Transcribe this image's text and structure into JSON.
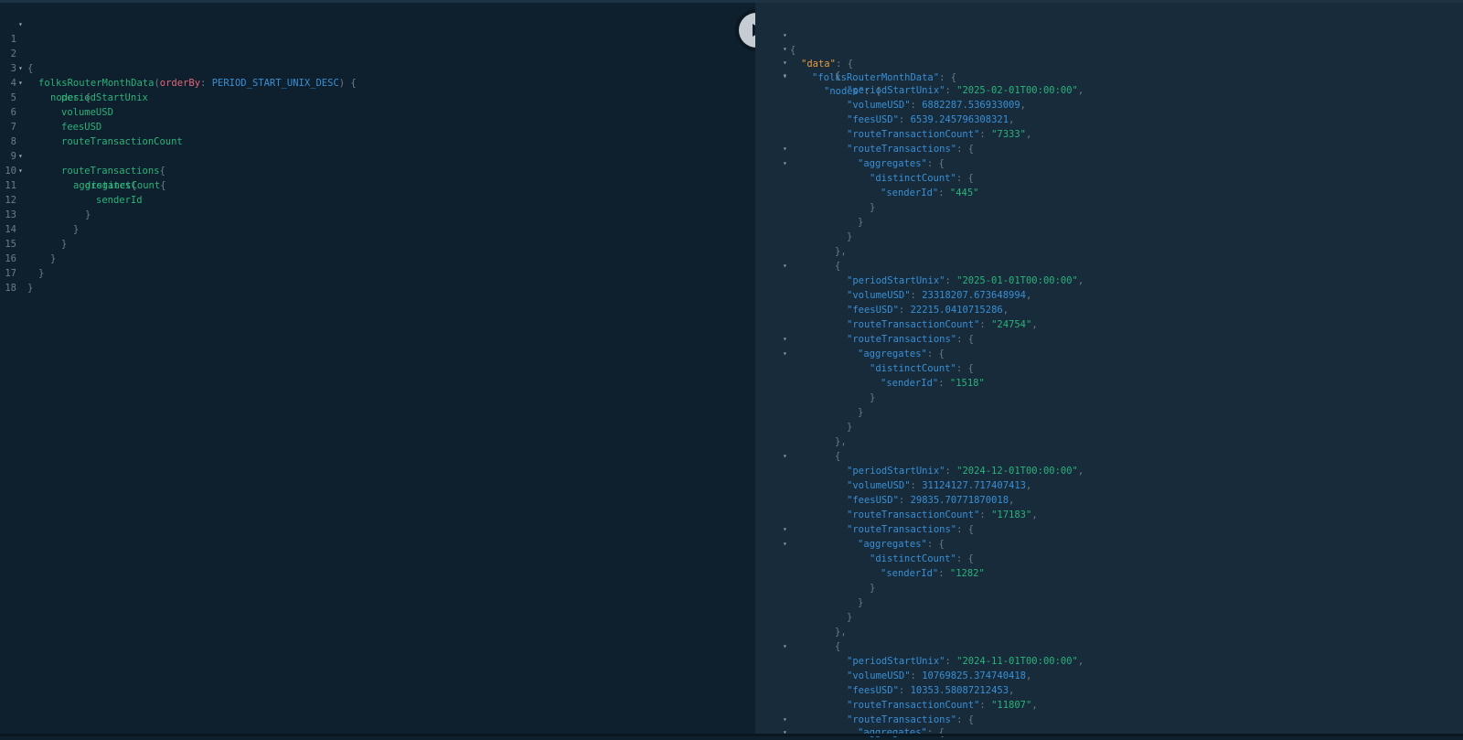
{
  "query": {
    "line_numbers": [
      "1",
      "2",
      "3",
      "4",
      "5",
      "6",
      "7",
      "8",
      "9",
      "10",
      "11",
      "12",
      "13",
      "14",
      "15",
      "16",
      "17",
      "18"
    ],
    "root": "folksRouterMonthData",
    "arg_name": "orderBy",
    "arg_value": "PERIOD_START_UNIX_DESC",
    "nodes": "nodes",
    "f_period": "periodStartUnix",
    "f_volume": "volumeUSD",
    "f_fees": "feesUSD",
    "f_count": "routeTransactionCount",
    "f_route": "routeTransactions",
    "f_aggregates": "aggregates",
    "f_distinct": "distinctCount",
    "f_sender": "senderId"
  },
  "result": {
    "k_data": "\"data\"",
    "k_root": "\"folksRouterMonthData\"",
    "k_nodes": "\"nodes\"",
    "k_period": "\"periodStartUnix\"",
    "k_volume": "\"volumeUSD\"",
    "k_fees": "\"feesUSD\"",
    "k_count": "\"routeTransactionCount\"",
    "k_route": "\"routeTransactions\"",
    "k_aggregates": "\"aggregates\"",
    "k_distinct": "\"distinctCount\"",
    "k_sender": "\"senderId\"",
    "records": [
      {
        "period": "\"2025-02-01T00:00:00\"",
        "volume": "6882287.536933009",
        "fees": "6539.245796308321",
        "count": "\"7333\"",
        "sender": "\"445\""
      },
      {
        "period": "\"2025-01-01T00:00:00\"",
        "volume": "23318207.673648994",
        "fees": "22215.0410715286",
        "count": "\"24754\"",
        "sender": "\"1518\""
      },
      {
        "period": "\"2024-12-01T00:00:00\"",
        "volume": "31124127.717407413",
        "fees": "29835.70771870018",
        "count": "\"17183\"",
        "sender": "\"1282\""
      },
      {
        "period": "\"2024-11-01T00:00:00\"",
        "volume": "10769825.374740418",
        "fees": "10353.58087212453",
        "count": "\"11807\""
      }
    ]
  },
  "toolbar": {
    "run_icon": "play-icon"
  }
}
